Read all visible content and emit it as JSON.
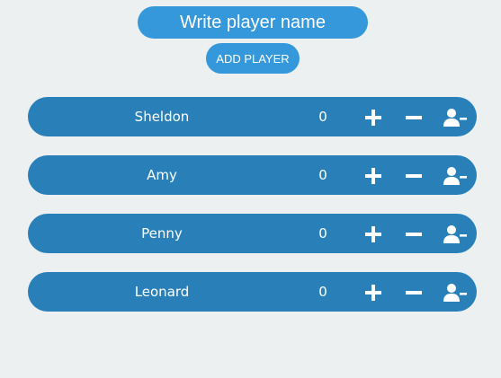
{
  "header": {
    "name_input": {
      "placeholder": "Write player name",
      "value": ""
    },
    "add_button_label": "ADD PLAYER"
  },
  "players": [
    {
      "name": "Sheldon",
      "score": "0"
    },
    {
      "name": "Amy",
      "score": "0"
    },
    {
      "name": "Penny",
      "score": "0"
    },
    {
      "name": "Leonard",
      "score": "0"
    }
  ],
  "icons": {
    "increment": "plus-icon",
    "decrement": "minus-icon",
    "remove": "user-remove-icon"
  },
  "colors": {
    "background": "#ecf0f1",
    "input_and_button": "#3498db",
    "player_row": "#2980b9",
    "text": "#ffffff"
  }
}
